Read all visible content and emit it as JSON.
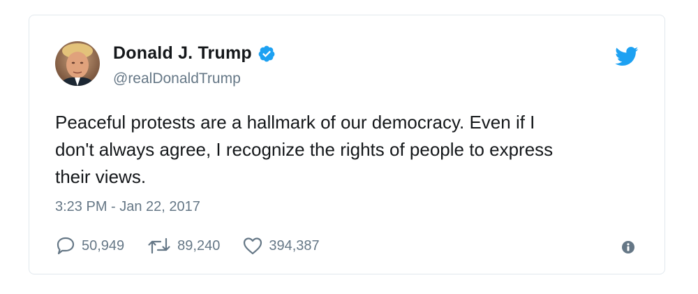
{
  "author": {
    "display_name": "Donald J. Trump",
    "handle": "@realDonaldTrump",
    "verified": true,
    "avatar_icon": "profile-photo"
  },
  "tweet": {
    "text": "Peaceful protests are a hallmark of our democracy. Even if I\ndon't always agree, I recognize the rights of people to express\ntheir views.",
    "timestamp": "3:23 PM - Jan 22, 2017"
  },
  "actions": {
    "replies": "50,949",
    "retweets": "89,240",
    "likes": "394,387"
  },
  "icons": {
    "verified": "verified-badge-icon",
    "brand": "twitter-bird-icon",
    "reply": "speech-bubble-icon",
    "retweet": "retweet-arrows-icon",
    "like": "heart-icon",
    "info": "info-circle-icon"
  },
  "colors": {
    "brand_blue": "#1da1f2",
    "text_primary": "#14171a",
    "text_secondary": "#657786",
    "border": "#e1e8ed"
  }
}
